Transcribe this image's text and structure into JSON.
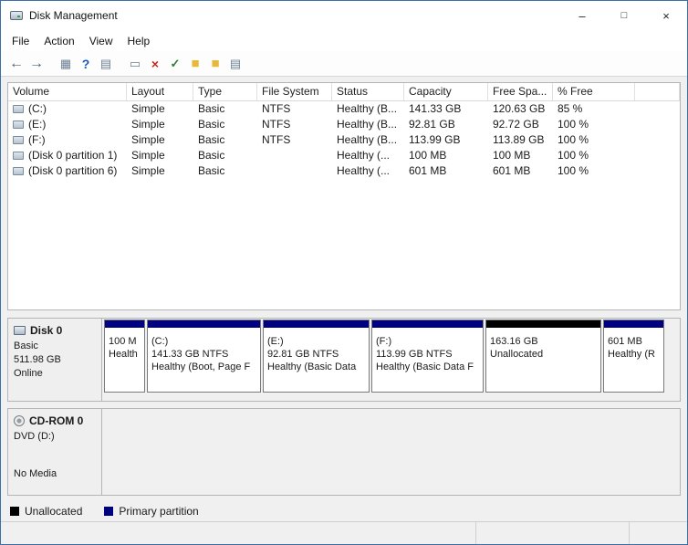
{
  "window": {
    "title": "Disk Management",
    "controls": {
      "minimize": "–",
      "maximize": "□",
      "close": "×"
    }
  },
  "menu": {
    "items": [
      {
        "label": "File"
      },
      {
        "label": "Action"
      },
      {
        "label": "View"
      },
      {
        "label": "Help"
      }
    ]
  },
  "toolbar": {
    "icons": [
      {
        "name": "back",
        "glyph": "←"
      },
      {
        "name": "forward",
        "glyph": "→"
      },
      {
        "name": "console-tree",
        "glyph": "▦"
      },
      {
        "name": "help",
        "glyph": "?"
      },
      {
        "name": "export-list",
        "glyph": "▤"
      },
      {
        "name": "properties",
        "glyph": "▭"
      },
      {
        "name": "delete-volume",
        "glyph": "×"
      },
      {
        "name": "mark-active",
        "glyph": "✓"
      },
      {
        "name": "open-folder",
        "glyph": "■"
      },
      {
        "name": "explore",
        "glyph": "■"
      },
      {
        "name": "fields",
        "glyph": "▤"
      }
    ]
  },
  "table": {
    "columns": [
      {
        "label": "Volume"
      },
      {
        "label": "Layout"
      },
      {
        "label": "Type"
      },
      {
        "label": "File System"
      },
      {
        "label": "Status"
      },
      {
        "label": "Capacity"
      },
      {
        "label": "Free Spa..."
      },
      {
        "label": "% Free"
      }
    ],
    "rows": [
      {
        "volume": "(C:)",
        "layout": "Simple",
        "type": "Basic",
        "fs": "NTFS",
        "status": "Healthy (B...",
        "capacity": "141.33 GB",
        "free": "120.63 GB",
        "pct_free": "85 %"
      },
      {
        "volume": "(E:)",
        "layout": "Simple",
        "type": "Basic",
        "fs": "NTFS",
        "status": "Healthy (B...",
        "capacity": "92.81 GB",
        "free": "92.72 GB",
        "pct_free": "100 %"
      },
      {
        "volume": "(F:)",
        "layout": "Simple",
        "type": "Basic",
        "fs": "NTFS",
        "status": "Healthy (B...",
        "capacity": "113.99 GB",
        "free": "113.89 GB",
        "pct_free": "100 %"
      },
      {
        "volume": "(Disk 0 partition 1)",
        "layout": "Simple",
        "type": "Basic",
        "fs": "",
        "status": "Healthy (...",
        "capacity": "100 MB",
        "free": "100 MB",
        "pct_free": "100 %"
      },
      {
        "volume": "(Disk 0 partition 6)",
        "layout": "Simple",
        "type": "Basic",
        "fs": "",
        "status": "Healthy (...",
        "capacity": "601 MB",
        "free": "601 MB",
        "pct_free": "100 %"
      }
    ]
  },
  "disk0": {
    "name": "Disk 0",
    "kind": "Basic",
    "size": "511.98 GB",
    "status": "Online",
    "partitions": [
      {
        "line1": "100 M",
        "line2": "Health",
        "line3": ""
      },
      {
        "line1": "(C:)",
        "line2": "141.33 GB NTFS",
        "line3": "Healthy (Boot, Page F"
      },
      {
        "line1": "(E:)",
        "line2": "92.81 GB NTFS",
        "line3": "Healthy (Basic Data"
      },
      {
        "line1": "(F:)",
        "line2": "113.99 GB NTFS",
        "line3": "Healthy (Basic Data F"
      },
      {
        "line1": "163.16 GB",
        "line2": "Unallocated",
        "line3": ""
      },
      {
        "line1": "601 MB",
        "line2": "Healthy (R",
        "line3": ""
      }
    ]
  },
  "cdrom": {
    "name": "CD-ROM 0",
    "kind": "DVD (D:)",
    "status": "No Media"
  },
  "legend": {
    "unallocated": "Unallocated",
    "primary": "Primary partition"
  },
  "colors": {
    "primary_partition": "#000082",
    "unallocated": "#000000"
  }
}
